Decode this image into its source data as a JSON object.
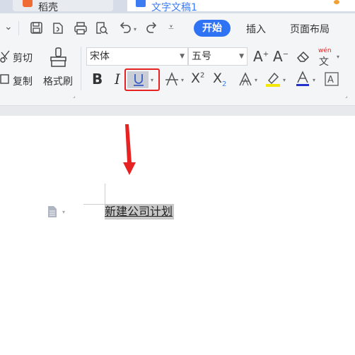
{
  "tabs": [
    {
      "label": "稻壳"
    },
    {
      "label": "文字文稿1"
    }
  ],
  "menu": {
    "start": "开始",
    "insert": "插入",
    "layout": "页面布局"
  },
  "clipboard": {
    "cut": "剪切",
    "copy": "复制",
    "format_painter": "格式刷"
  },
  "font": {
    "name": "宋体",
    "size": "五号"
  },
  "pinyin_label": "wén",
  "document": {
    "text": "新建公司计划"
  },
  "colors": {
    "accent": "#2f73f5",
    "highlight_box": "#e62222",
    "arrow": "#e62222",
    "highlighter": "#f5e600",
    "font_color": "#e62222"
  }
}
